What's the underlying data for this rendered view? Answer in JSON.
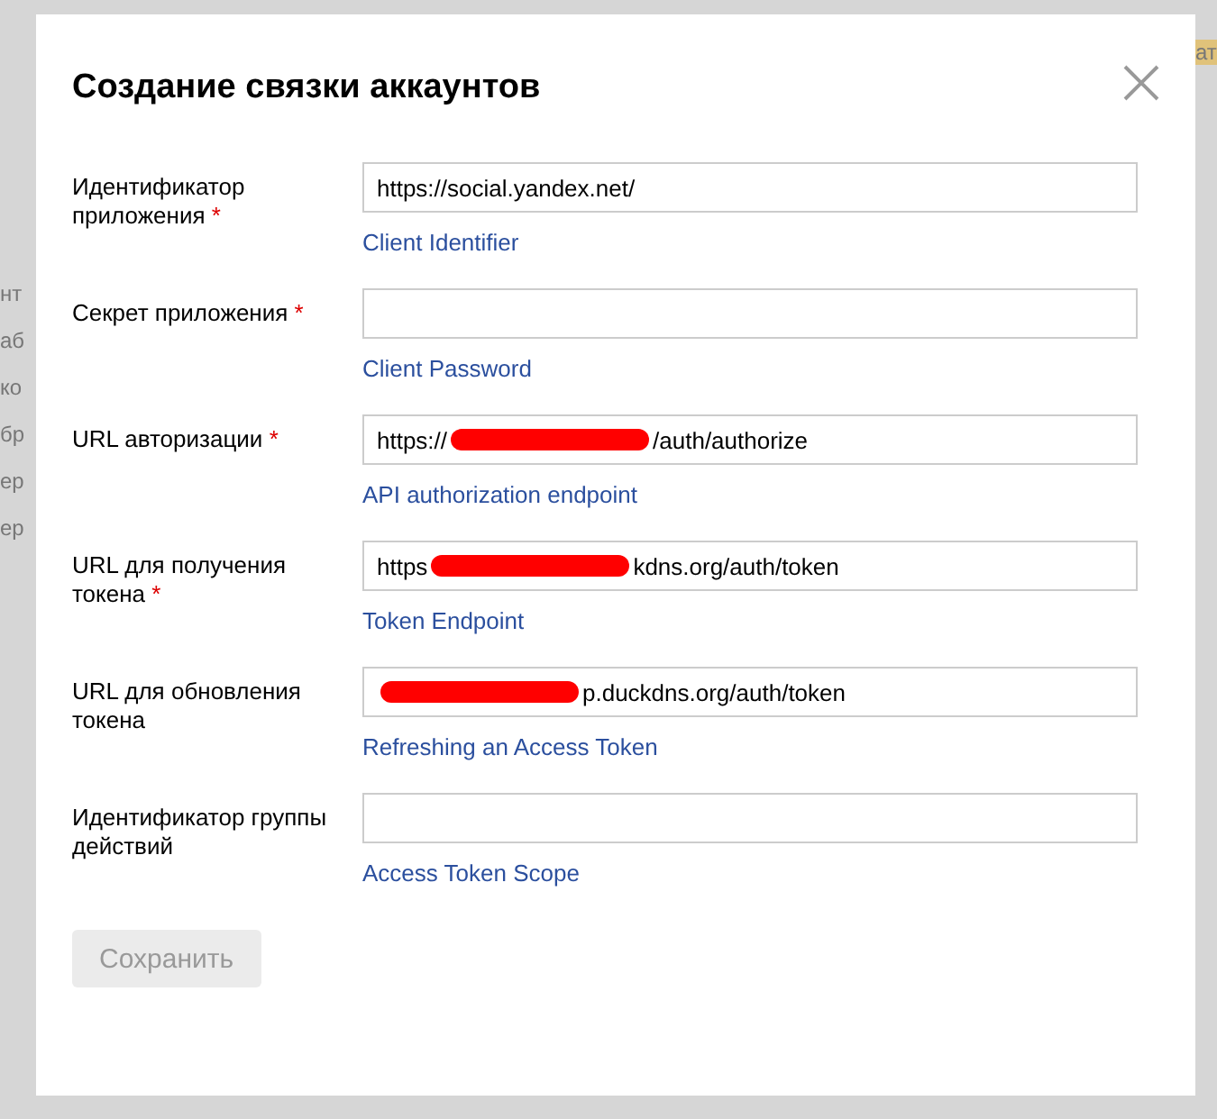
{
  "background": {
    "left_fragments": [
      "нт",
      "аб",
      "ко",
      "бр",
      "ер",
      "ер"
    ],
    "right_fragments": [
      "ат"
    ]
  },
  "dialog": {
    "title": "Создание связки аккаунтов",
    "fields": [
      {
        "label": "Идентификатор приложения",
        "required_mark": "*",
        "value_before": "https://social.yandex.net/",
        "redacted": false,
        "hint": "Client Identifier"
      },
      {
        "label": "Секрет приложения",
        "required_mark": "*",
        "redacted": false,
        "hint": "Client Password"
      },
      {
        "label": "URL авторизации",
        "required_mark": "*",
        "value_before": "https://",
        "value_after": "/auth/authorize",
        "redacted": true,
        "hint": "API authorization endpoint"
      },
      {
        "label": "URL для получения токена",
        "required_mark": "*",
        "value_before": "https",
        "value_after": "kdns.org/auth/token",
        "redacted": true,
        "hint": "Token Endpoint"
      },
      {
        "label": "URL для обновления токена",
        "value_after": "p.duckdns.org/auth/token",
        "redacted": true,
        "hint": "Refreshing an Access Token"
      },
      {
        "label": "Идентификатор группы действий",
        "redacted": false,
        "hint": "Access Token Scope"
      }
    ],
    "save_button": {
      "label": "Сохранить",
      "disabled": true
    }
  }
}
